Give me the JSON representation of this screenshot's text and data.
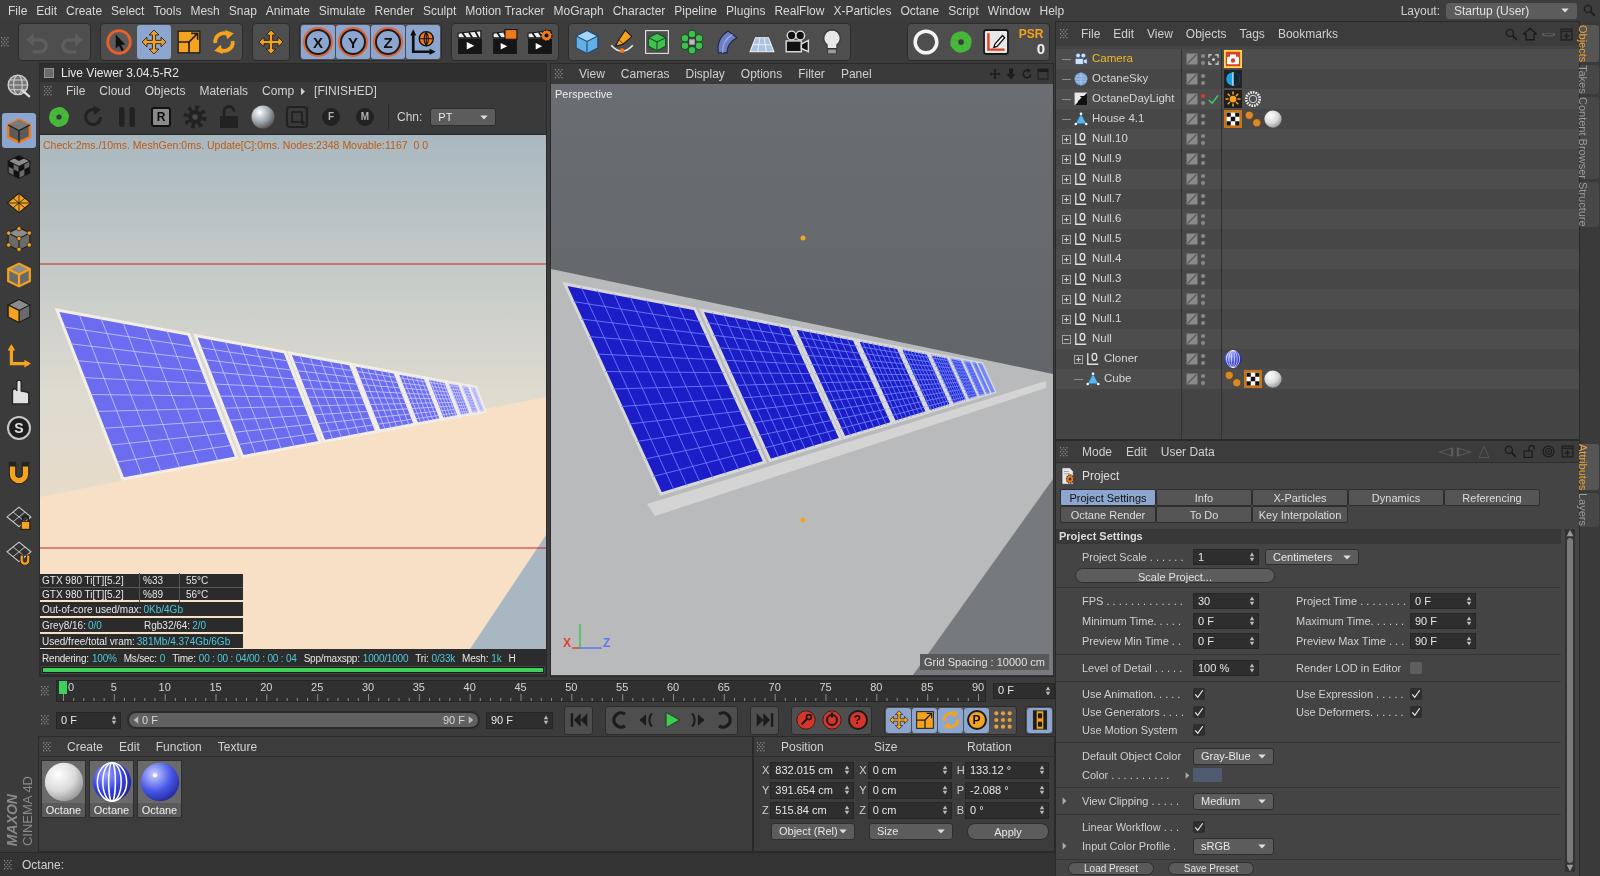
{
  "menu_bar": {
    "items": [
      "File",
      "Edit",
      "Create",
      "Select",
      "Tools",
      "Mesh",
      "Snap",
      "Animate",
      "Simulate",
      "Render",
      "Sculpt",
      "Motion Tracker",
      "MoGraph",
      "Character",
      "Pipeline",
      "Plugins",
      "RealFlow",
      "X-Particles",
      "Octane",
      "Script",
      "Window",
      "Help"
    ],
    "layout_label": "Layout:",
    "layout_value": "Startup (User)"
  },
  "toolbar": {
    "groups": [
      {
        "disabled": true,
        "buttons": [
          {
            "kind": "undo"
          },
          {
            "kind": "redo"
          }
        ]
      },
      {
        "disabled": false,
        "buttons": [
          {
            "kind": "select",
            "selected": false
          },
          {
            "kind": "move",
            "selected": true
          },
          {
            "kind": "scale",
            "selected": false
          },
          {
            "kind": "rotate",
            "selected": false
          }
        ]
      },
      {
        "disabled": false,
        "buttons": [
          {
            "kind": "move"
          }
        ]
      },
      {
        "disabled": false,
        "buttons": [
          {
            "kind": "axis",
            "label": "X",
            "selected": true
          },
          {
            "kind": "axis",
            "label": "Y",
            "selected": true
          },
          {
            "kind": "axis",
            "label": "Z",
            "selected": true
          },
          {
            "kind": "world",
            "selected": true
          }
        ]
      },
      {
        "disabled": false,
        "buttons": [
          {
            "kind": "render-view"
          },
          {
            "kind": "render-picture"
          },
          {
            "kind": "render-settings"
          }
        ]
      },
      {
        "disabled": false,
        "buttons": [
          {
            "kind": "cube"
          },
          {
            "kind": "pen"
          },
          {
            "kind": "subdivision"
          },
          {
            "kind": "cloner"
          },
          {
            "kind": "deformer"
          },
          {
            "kind": "floor"
          },
          {
            "kind": "camera"
          },
          {
            "kind": "light"
          }
        ]
      },
      {
        "disabled": false,
        "buttons": [
          {
            "kind": "ring"
          },
          {
            "kind": "octane"
          },
          {
            "kind": "region-edit"
          },
          {
            "kind": "psr",
            "label": "PSR",
            "count": "0"
          }
        ]
      }
    ]
  },
  "left_toolbar": {
    "groups": [
      [
        {
          "kind": "globe-grid",
          "selected": false
        }
      ],
      [
        {
          "kind": "model",
          "selected": true
        },
        {
          "kind": "texture-cube",
          "selected": false
        },
        {
          "kind": "texture-grid",
          "selected": false
        },
        {
          "kind": "points",
          "selected": false
        },
        {
          "kind": "edges",
          "selected": false
        },
        {
          "kind": "polygons",
          "selected": false
        }
      ],
      [
        {
          "kind": "axis-mode",
          "selected": false
        },
        {
          "kind": "tweak",
          "selected": false
        },
        {
          "kind": "snap",
          "label": "S",
          "selected": false
        }
      ],
      [
        {
          "kind": "magnet",
          "selected": false
        }
      ],
      [
        {
          "kind": "workplane-lock",
          "selected": false
        },
        {
          "kind": "grid-magnet",
          "selected": false
        }
      ]
    ],
    "logo": "MAXON",
    "product": "CINEMA 4D"
  },
  "live_viewer": {
    "title": "Live Viewer 3.04.5-R2",
    "menu": [
      "File",
      "Cloud",
      "Objects",
      "Materials",
      "Comp"
    ],
    "status": "[FINISHED]",
    "tools": [
      {
        "kind": "octane"
      },
      {
        "kind": "refresh"
      },
      {
        "kind": "pause"
      },
      {
        "kind": "region-r",
        "label": "R"
      },
      {
        "kind": "gear"
      },
      {
        "kind": "lock"
      },
      {
        "kind": "sphere"
      },
      {
        "kind": "frame"
      },
      {
        "kind": "pin",
        "label": "F"
      },
      {
        "kind": "pin",
        "label": "M"
      }
    ],
    "channel_label": "Chn:",
    "channel_value": "PT",
    "info_line": "Check:2ms./10ms. MeshGen:0ms. Update[C]:0ms. Nodes:2348 Movable:1167  0 0",
    "gpus": [
      {
        "name": "GTX 980 Ti[T][5.2]",
        "load": "%33",
        "temp": "55°C"
      },
      {
        "name": "GTX 980 Ti[T][5.2]",
        "load": "%89",
        "temp": "56°C"
      }
    ],
    "stats": [
      [
        {
          "label": "Out-of-core used/max:",
          "value": "0Kb/4Gb"
        }
      ],
      [
        {
          "label": "Grey8/16:",
          "value": "0/0"
        },
        {
          "label": "Rgb32/64:",
          "value": "2/0"
        }
      ],
      [
        {
          "label": "Used/free/total vram:",
          "value": "381Mb/4.374Gb/6Gb"
        }
      ]
    ],
    "render_stats": [
      {
        "label": "Rendering:",
        "value": "100%"
      },
      {
        "label": "Ms/sec:",
        "value": "0"
      },
      {
        "label": "Time:",
        "value": "00 : 00 : 04/00 : 00 : 04"
      },
      {
        "label": "Spp/maxspp:",
        "value": "1000/1000"
      },
      {
        "label": "Tri:",
        "value": "0/33k"
      },
      {
        "label": "Mesh:",
        "value": "1k"
      },
      {
        "label": "H"
      }
    ],
    "progress": {
      "level": 1
    }
  },
  "viewport": {
    "menu": [
      "View",
      "Cameras",
      "Display",
      "Options",
      "Filter",
      "Panel"
    ],
    "camera": "Perspective",
    "grid_spacing": "Grid Spacing : 10000 cm",
    "axes": [
      {
        "label": "X",
        "color": "#e0402f"
      },
      {
        "label": "Z",
        "color": "#5a78f0"
      }
    ]
  },
  "timeline": {
    "ticks": [
      "0",
      "5",
      "10",
      "15",
      "20",
      "25",
      "30",
      "35",
      "40",
      "45",
      "50",
      "55",
      "60",
      "65",
      "70",
      "75",
      "80",
      "85",
      "90"
    ],
    "playhead": {
      "level": 0
    },
    "current_frame": "0 F"
  },
  "transport": {
    "start_field": "0 F",
    "range": {
      "start": "0 F",
      "end": "90 F",
      "level": 1
    },
    "end_field": "90 F",
    "groups": [
      [
        {
          "kind": "go-start"
        }
      ],
      [
        {
          "kind": "step-back"
        },
        {
          "kind": "key-back"
        },
        {
          "kind": "play"
        },
        {
          "kind": "key-forward"
        },
        {
          "kind": "step-forward"
        }
      ],
      [
        {
          "kind": "go-end"
        }
      ],
      [
        {
          "kind": "record"
        },
        {
          "kind": "autokey"
        },
        {
          "kind": "keys",
          "label": "?"
        }
      ],
      [
        {
          "kind": "move",
          "selected": true
        },
        {
          "kind": "scale",
          "selected": true
        },
        {
          "kind": "rotate",
          "selected": true
        },
        {
          "kind": "param",
          "label": "P",
          "selected": true
        },
        {
          "kind": "dots",
          "selected": false
        }
      ],
      [
        {
          "kind": "film",
          "selected": true
        }
      ]
    ]
  },
  "material_manager": {
    "menu": [
      "Create",
      "Edit",
      "Function",
      "Texture"
    ],
    "materials": [
      {
        "name": "Octane",
        "kind": "white"
      },
      {
        "name": "Octane",
        "kind": "striped"
      },
      {
        "name": "Octane",
        "kind": "blue"
      }
    ]
  },
  "coordinates": {
    "headers": [
      "Position",
      "Size",
      "Rotation"
    ],
    "rows": [
      [
        {
          "axis": "X",
          "value": "832.015 cm"
        },
        {
          "axis": "X",
          "value": "0 cm"
        },
        {
          "axis": "H",
          "value": "133.12 °"
        }
      ],
      [
        {
          "axis": "Y",
          "value": "391.654 cm"
        },
        {
          "axis": "Y",
          "value": "0 cm"
        },
        {
          "axis": "P",
          "value": "-2.088 °"
        }
      ],
      [
        {
          "axis": "Z",
          "value": "515.84 cm"
        },
        {
          "axis": "Z",
          "value": "0 cm"
        },
        {
          "axis": "B",
          "value": "0 °"
        }
      ]
    ],
    "mode": "Object (Rel)",
    "size_mode": "Size",
    "apply": "Apply"
  },
  "status_bar": {
    "text": "Octane:"
  },
  "object_manager": {
    "menu": [
      "File",
      "Edit",
      "View",
      "Objects",
      "Tags",
      "Bookmarks"
    ],
    "objects": [
      {
        "name": "Camera",
        "kind": "camera",
        "selected": true,
        "editor_off": false,
        "active_camera": true,
        "tags": [
          {
            "kind": "camera",
            "selected": true
          }
        ]
      },
      {
        "name": "OctaneSky",
        "kind": "sky",
        "selected": false,
        "editor_off": false,
        "tags": [
          {
            "kind": "environment",
            "selected": false
          }
        ]
      },
      {
        "name": "OctaneDayLight",
        "kind": "daylight",
        "selected": false,
        "editor_off": true,
        "enabled": true,
        "tags": [
          {
            "kind": "sun",
            "selected": false
          },
          {
            "kind": "light-ring",
            "selected": false
          }
        ]
      },
      {
        "name": "House 4.1",
        "kind": "polygon",
        "selected": false,
        "editor_off": false,
        "tags": [
          {
            "kind": "checker",
            "selected": false
          },
          {
            "kind": "points",
            "selected": false
          },
          {
            "kind": "material",
            "selected": false
          }
        ]
      },
      {
        "name": "Null.10",
        "kind": "null",
        "expanded": false,
        "selected": false,
        "editor_off": false
      },
      {
        "name": "Null.9",
        "kind": "null",
        "expanded": false,
        "selected": false,
        "editor_off": false
      },
      {
        "name": "Null.8",
        "kind": "null",
        "expanded": false,
        "selected": false,
        "editor_off": false
      },
      {
        "name": "Null.7",
        "kind": "null",
        "expanded": false,
        "selected": false,
        "editor_off": false
      },
      {
        "name": "Null.6",
        "kind": "null",
        "expanded": false,
        "selected": false,
        "editor_off": false
      },
      {
        "name": "Null.5",
        "kind": "null",
        "expanded": false,
        "selected": false,
        "editor_off": false
      },
      {
        "name": "Null.4",
        "kind": "null",
        "expanded": false,
        "selected": false,
        "editor_off": false
      },
      {
        "name": "Null.3",
        "kind": "null",
        "expanded": false,
        "selected": false,
        "editor_off": false
      },
      {
        "name": "Null.2",
        "kind": "null",
        "expanded": false,
        "selected": false,
        "editor_off": false
      },
      {
        "name": "Null.1",
        "kind": "null",
        "expanded": false,
        "selected": false,
        "editor_off": false
      },
      {
        "name": "Null",
        "kind": "null",
        "expanded": true,
        "selected": false,
        "editor_off": false,
        "children": [
          {
            "name": "Cloner",
            "kind": "null",
            "expanded": false,
            "selected": false,
            "editor_off": false,
            "tags": [
              {
                "kind": "material-striped",
                "selected": false
              }
            ]
          },
          {
            "name": "Cube",
            "kind": "polygon",
            "selected": false,
            "editor_off": false,
            "tags": [
              {
                "kind": "points",
                "selected": false
              },
              {
                "kind": "checker",
                "selected": false
              },
              {
                "kind": "material",
                "selected": false
              }
            ]
          }
        ]
      }
    ]
  },
  "side_tabs_top": [
    {
      "label": "Objects",
      "selected": true
    },
    {
      "label": "Takes",
      "selected": false
    },
    {
      "label": "Content Browser",
      "selected": false
    },
    {
      "label": "Structure",
      "selected": false
    }
  ],
  "attributes": {
    "menu": [
      "Mode",
      "Edit",
      "User Data"
    ],
    "object": "Project",
    "tabs": [
      {
        "label": "Project Settings",
        "selected": true
      },
      {
        "label": "Info",
        "selected": false
      },
      {
        "label": "X-Particles",
        "selected": false
      },
      {
        "label": "Dynamics",
        "selected": false
      },
      {
        "label": "Referencing",
        "selected": false
      },
      {
        "label": "Octane Render",
        "selected": false
      },
      {
        "label": "To Do",
        "selected": false
      },
      {
        "label": "Key Interpolation",
        "selected": false
      }
    ],
    "section": "Project Settings",
    "groups": [
      [
        [
          {
            "kind": "number",
            "label": "Project Scale . . . . . .",
            "value": "1",
            "unit": "Centimeters"
          }
        ],
        [
          {
            "kind": "button",
            "label": "Scale Project..."
          }
        ]
      ],
      [
        [
          {
            "kind": "number",
            "label": "FPS . . . . . . . . . . . . .",
            "value": "30"
          },
          {
            "kind": "number",
            "label": "Project Time . . . . . . . .",
            "value": "0 F"
          }
        ],
        [
          {
            "kind": "number",
            "label": "Minimum Time. . . . .",
            "value": "0 F"
          },
          {
            "kind": "number",
            "label": "Maximum Time. . . . . .",
            "value": "90 F"
          }
        ],
        [
          {
            "kind": "number",
            "label": "Preview Min Time . .",
            "value": "0 F"
          },
          {
            "kind": "number",
            "label": "Preview Max Time . . .",
            "value": "90 F"
          }
        ]
      ],
      [
        [
          {
            "kind": "number",
            "label": "Level of Detail . . . . .",
            "value": "100 %"
          },
          {
            "kind": "checkbox",
            "label": "Render LOD in Editor",
            "checked": false
          }
        ]
      ],
      [
        [
          {
            "kind": "checkbox",
            "label": "Use Animation. . . . .",
            "checked": true
          },
          {
            "kind": "checkbox",
            "label": "Use Expression . . . . .",
            "checked": true
          }
        ],
        [
          {
            "kind": "checkbox",
            "label": "Use Generators . . . .",
            "checked": true
          },
          {
            "kind": "checkbox",
            "label": "Use Deformers. . . . . .",
            "checked": true
          }
        ],
        [
          {
            "kind": "checkbox",
            "label": "Use Motion System",
            "checked": true
          }
        ]
      ],
      [
        [
          {
            "kind": "dropdown",
            "label": "Default Object Color",
            "value": "Gray-Blue"
          }
        ],
        [
          {
            "kind": "color",
            "label": "Color . . . . . . . . . .",
            "color": "#4f5b70"
          }
        ]
      ],
      [
        [
          {
            "kind": "dropdown",
            "label": "View Clipping . . . . .",
            "value": "Medium",
            "expandable": true
          }
        ]
      ],
      [
        [
          {
            "kind": "checkbox",
            "label": "Linear Workflow . . .",
            "checked": true
          }
        ],
        [
          {
            "kind": "dropdown",
            "label": "Input Color Profile .",
            "value": "sRGB",
            "expandable": true
          }
        ]
      ]
    ],
    "presets": [
      "Load Preset",
      "Save Preset"
    ]
  },
  "side_tabs_bottom": [
    {
      "label": "Attributes",
      "selected": true
    },
    {
      "label": "Layers",
      "selected": false
    }
  ]
}
